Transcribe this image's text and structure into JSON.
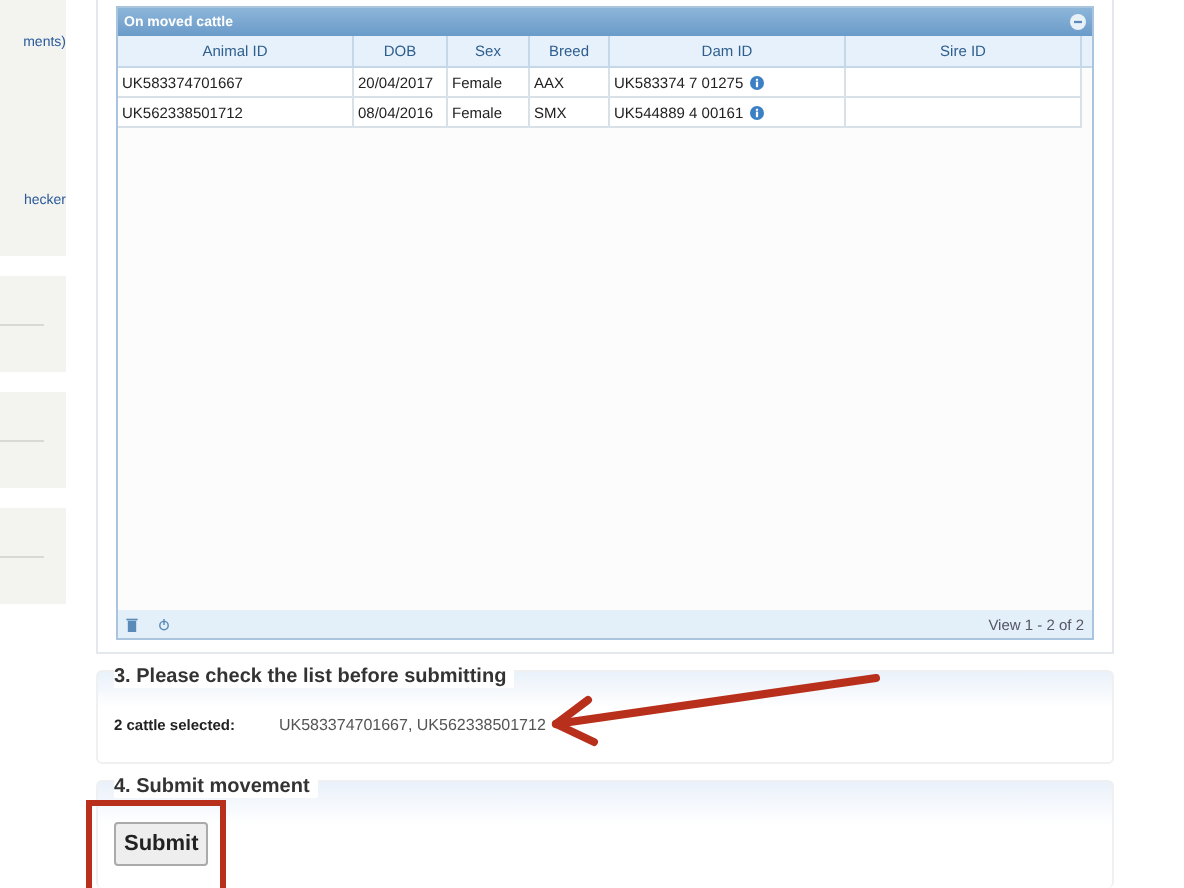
{
  "sidebar": {
    "items": [
      {
        "text": "ments)"
      },
      {
        "text": "hecker"
      }
    ]
  },
  "grid": {
    "title": "On moved cattle",
    "columns": [
      "Animal ID",
      "DOB",
      "Sex",
      "Breed",
      "Dam ID",
      "Sire ID"
    ],
    "rows": [
      {
        "cells": [
          "UK583374701667",
          "20/04/2017",
          "Female",
          "AAX",
          "UK583374 7 01275",
          ""
        ]
      },
      {
        "cells": [
          "UK562338501712",
          "08/04/2016",
          "Female",
          "SMX",
          "UK544889 4 00161",
          ""
        ]
      }
    ],
    "pager": "View 1 - 2 of 2"
  },
  "check_section": {
    "title": "3. Please check the list before submitting",
    "label": "2 cattle selected:",
    "value": "UK583374701667, UK562338501712"
  },
  "submit_section": {
    "title": "4. Submit movement",
    "button": "Submit"
  }
}
